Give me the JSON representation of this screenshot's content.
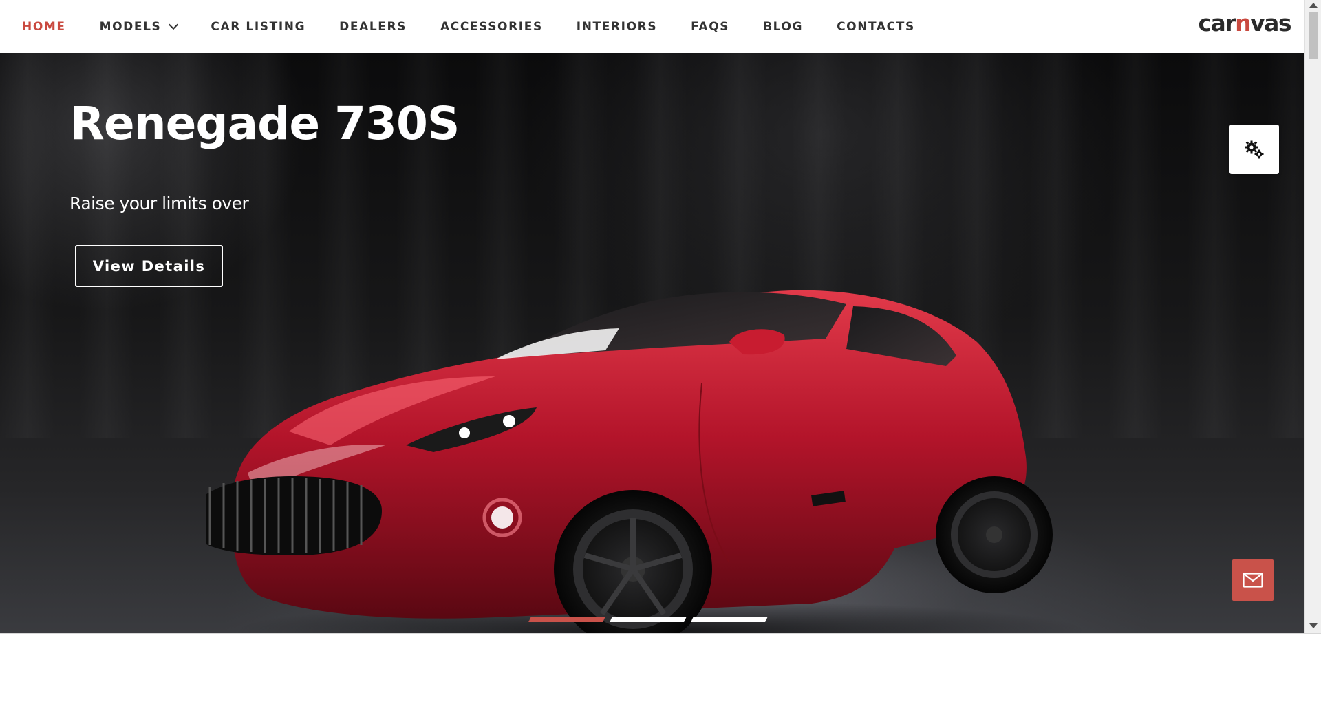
{
  "nav": {
    "items": [
      {
        "label": "HOME",
        "active": true
      },
      {
        "label": "MODELS",
        "has_dropdown": true
      },
      {
        "label": "CAR LISTING"
      },
      {
        "label": "DEALERS"
      },
      {
        "label": "ACCESSORIES"
      },
      {
        "label": "INTERIORS"
      },
      {
        "label": "FAQS"
      },
      {
        "label": "BLOG"
      },
      {
        "label": "CONTACTS"
      }
    ],
    "logo_prefix": "car",
    "logo_accent": "n",
    "logo_suffix": "vas"
  },
  "hero": {
    "title": "Renegade 730S",
    "subtitle": "Raise your limits over",
    "button_label": "View Details",
    "slides": {
      "count": 3,
      "active_index": 0
    }
  },
  "widgets": {
    "settings_icon": "gears-icon",
    "mail_icon": "envelope-icon"
  },
  "colors": {
    "accent": "#c9493f",
    "nav_text": "#333333",
    "hero_background": "#111111",
    "car_body": "#b3142a"
  }
}
